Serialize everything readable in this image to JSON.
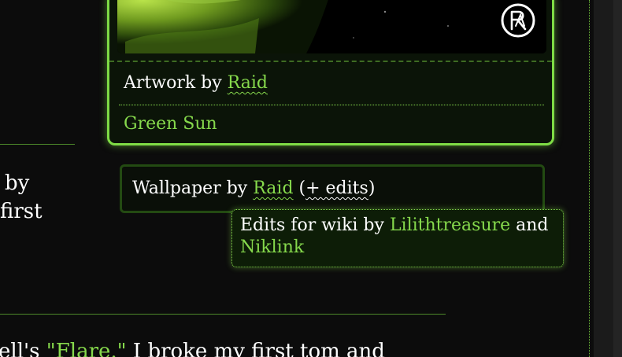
{
  "artwork_card": {
    "image_alt": "Green Sun artwork",
    "watermark_icon": "raid-signature-logo",
    "credit_prefix": "Artwork by ",
    "artist": "Raid",
    "title": "Green Sun"
  },
  "wallpaper": {
    "prefix": "Wallpaper by ",
    "artist": "Raid",
    "open_paren": " (",
    "edits_label": "+ edits",
    "close_paren": ")"
  },
  "tooltip": {
    "prefix": "Edits for wiki by ",
    "editor1": "Lilithtreasure",
    "joiner": " and ",
    "editor2": "Niklink"
  },
  "left_fragments": {
    "line1": "by",
    "line2": "first"
  },
  "bottom_text": {
    "before": "ell's ",
    "quote": "\"Flare.\"",
    "after": " I broke my first tom and"
  },
  "colors": {
    "accent": "#86d94c",
    "card_border": "#7fdc45",
    "background": "#0c0c0c"
  }
}
